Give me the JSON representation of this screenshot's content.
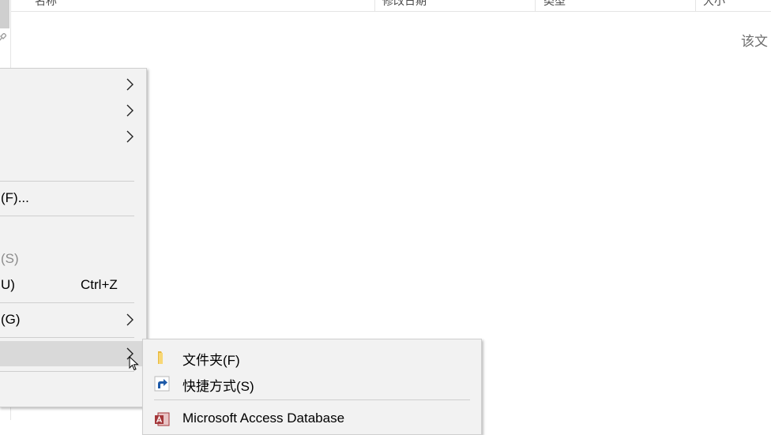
{
  "explorer": {
    "columns": [
      "名称",
      "修改日期",
      "类型",
      "大小"
    ],
    "empty_message": "该文"
  },
  "context_menu": {
    "items": [
      {
        "label": "",
        "submenu": true
      },
      {
        "label": "",
        "submenu": true
      },
      {
        "label": "",
        "submenu": true
      },
      {
        "label": "(F)..."
      },
      {
        "label": "(S)",
        "disabled": true
      },
      {
        "label": "U)",
        "shortcut": "Ctrl+Z"
      },
      {
        "label": "(G)",
        "submenu": true
      },
      {
        "label": "",
        "submenu": true,
        "highlighted": true
      }
    ]
  },
  "new_submenu": {
    "items": [
      {
        "label": "文件夹(F)",
        "icon": "folder-icon"
      },
      {
        "label": "快捷方式(S)",
        "icon": "shortcut-icon"
      },
      {
        "label": "Microsoft Access Database",
        "icon": "access-database-icon"
      }
    ]
  },
  "colors": {
    "menu_background": "#f2f2f2",
    "menu_highlight": "#d9d9d9",
    "folder_yellow": "#f8d775",
    "shortcut_blue": "#1e5aa8",
    "access_red": "#a4373a"
  }
}
